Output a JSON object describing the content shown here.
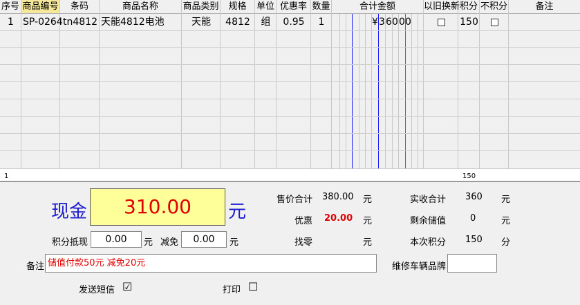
{
  "grid": {
    "headers": {
      "seq": "序号",
      "code": "商品编号",
      "barcode": "条码",
      "name": "商品名称",
      "category": "商品类别",
      "spec": "规格",
      "unit": "单位",
      "discount": "优惠率",
      "qty": "数量",
      "total": "合计金额",
      "trade_in": "以旧换新",
      "points": "积分",
      "no_points": "不积分",
      "remark": "备注"
    },
    "rows": [
      {
        "seq": "1",
        "code": "SP-0264",
        "barcode": "tn4812",
        "name": "天能4812电池",
        "category": "天能",
        "spec": "4812",
        "unit": "组",
        "discount": "0.95",
        "qty": "1",
        "currency": "¥",
        "d1": "3",
        "d2": "6",
        "d3": "0",
        "d4": "0",
        "d5": "0",
        "points": "150",
        "trade_in": false,
        "no_points": false
      }
    ],
    "footer": {
      "count": "1",
      "points_total": "150"
    }
  },
  "panel": {
    "cash_label": "现金",
    "cash_value": "310.00",
    "yuan_big": "元",
    "points_deduct_label": "积分抵现",
    "points_deduct_value": "0.00",
    "yuan": "元",
    "reduce_label": "减免",
    "reduce_value": "0.00",
    "sale_total_label": "售价合计",
    "sale_total_value": "380.00",
    "discount_label": "优惠",
    "discount_value": "20.00",
    "change_label": "找零",
    "change_value": "",
    "received_label": "实收合计",
    "received_value": "360",
    "balance_label": "剩余储值",
    "balance_value": "0",
    "points_label": "本次积分",
    "points_value": "150",
    "points_unit": "分",
    "remark_label": "备注",
    "remark_value": "储值付款50元 减免20元",
    "brand_label": "维修车辆品牌",
    "brand_value": "",
    "sms_label": "发送短信",
    "sms_checked": "☑",
    "print_label": "打印",
    "print_checked": "☐"
  },
  "colors": {
    "cash_bg": "#ffff99",
    "cash_text": "#e00000",
    "header_highlight": "#f6e89a",
    "label_blue": "#1a1acc"
  }
}
